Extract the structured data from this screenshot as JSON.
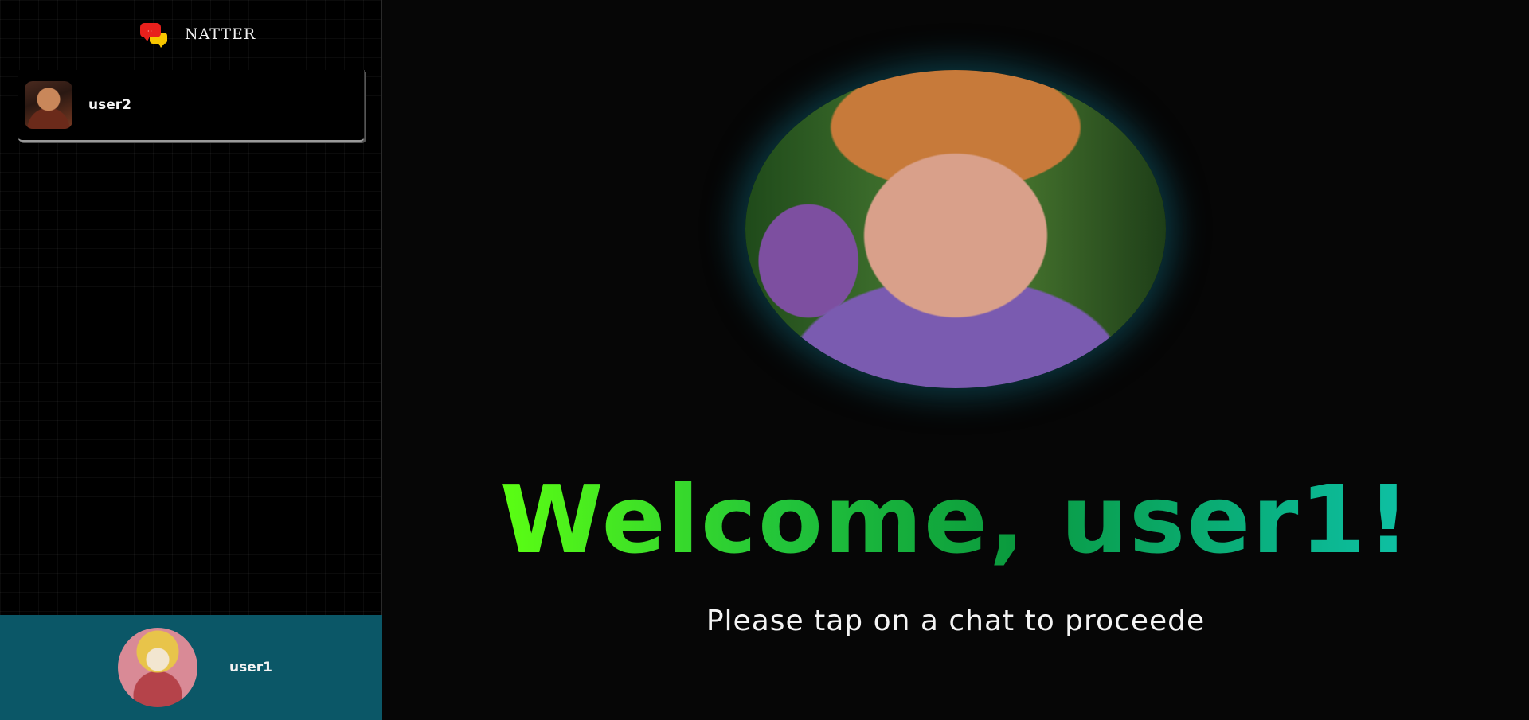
{
  "brand": {
    "name": "NATTER",
    "icon": "chat-bubbles-icon"
  },
  "chats": [
    {
      "name": "user2",
      "avatar": "user2-avatar"
    }
  ],
  "current_user": {
    "name": "user1",
    "avatar": "user1-avatar"
  },
  "main": {
    "hero_image": "welcome-gif",
    "welcome_text": "Welcome, user1!",
    "subtitle": "Please tap on a chat to proceede"
  },
  "colors": {
    "sidebar_bg": "#000000",
    "user_bar_bg": "#0b5767",
    "welcome_gradient_start": "#5cff12",
    "welcome_gradient_end": "#12c8b4",
    "glow": "#0e5c6e"
  }
}
